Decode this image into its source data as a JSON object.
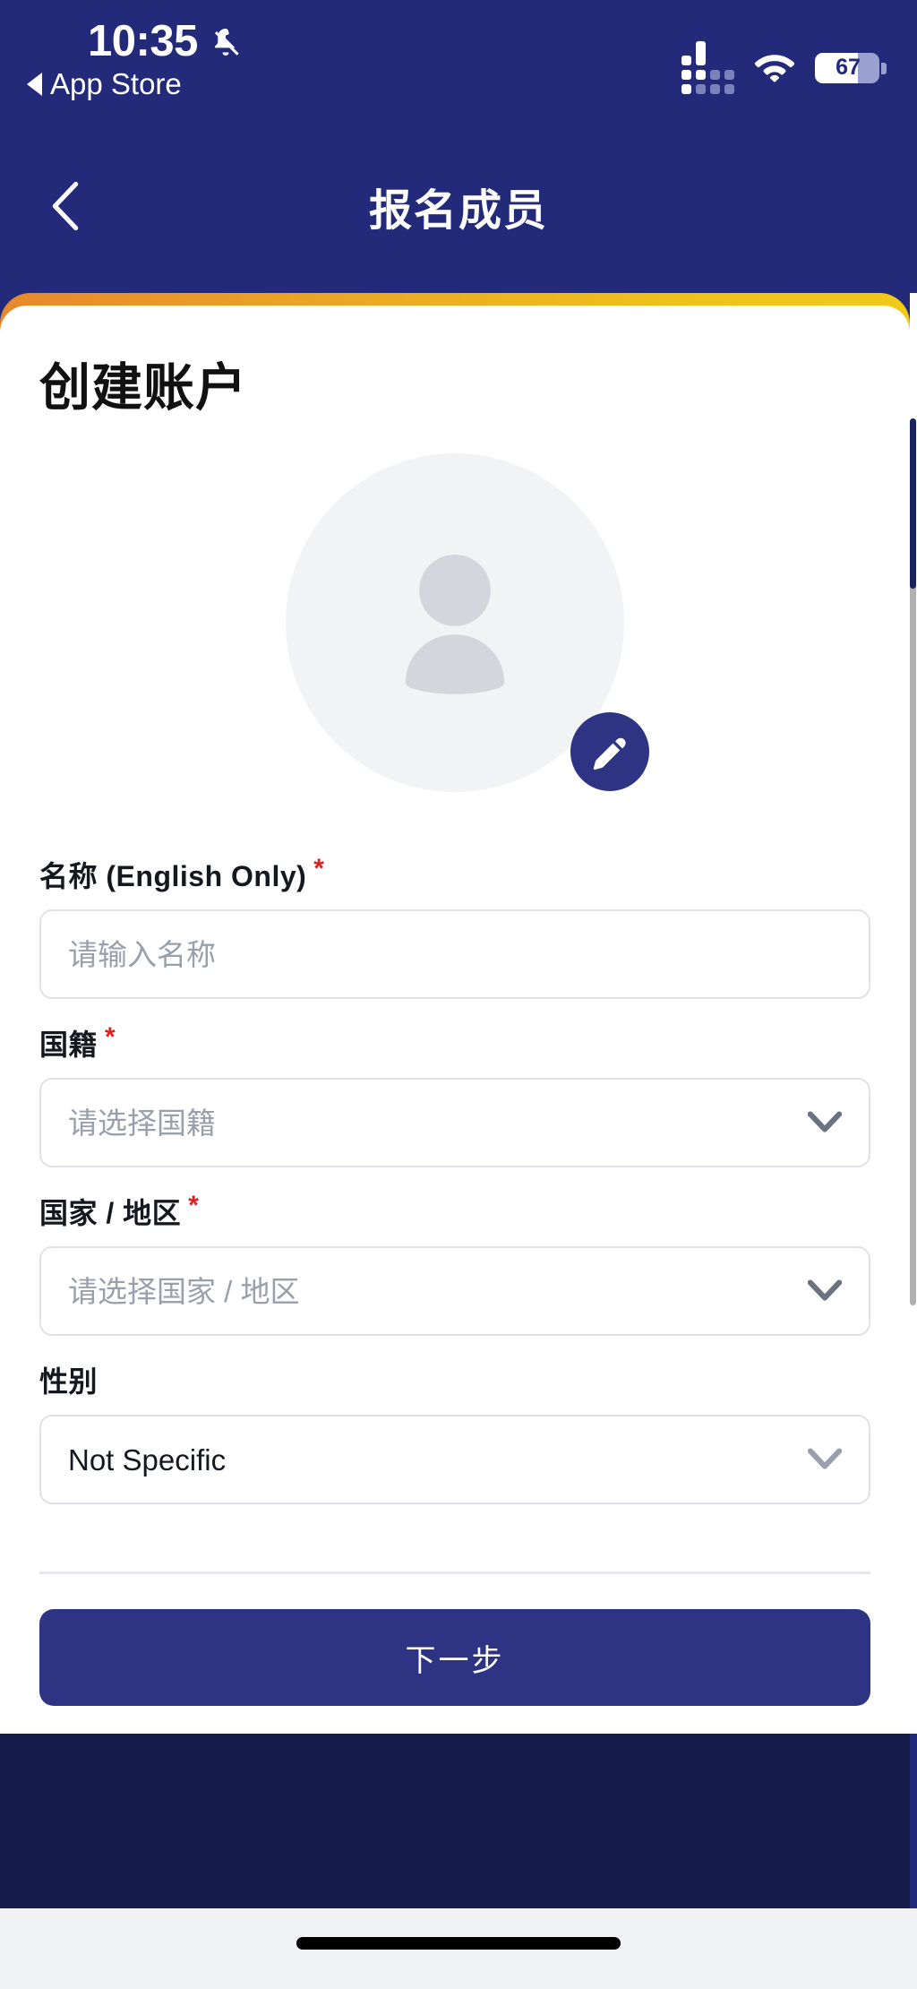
{
  "status_bar": {
    "time": "10:35",
    "bell_icon": "bell-muted-icon",
    "return_label": "App Store",
    "return_arrow_icon": "triangle-left-icon",
    "signal_icon": "cellular-signal-icon",
    "wifi_icon": "wifi-icon",
    "battery_percent": "67",
    "battery_level": 67
  },
  "nav": {
    "back_icon": "chevron-left-icon",
    "title": "报名成员"
  },
  "card": {
    "title": "创建账户",
    "gradient_start": "#E8892C",
    "gradient_end": "#F0CA18"
  },
  "avatar": {
    "placeholder_icon": "person-icon",
    "edit_icon": "pencil-icon",
    "edit_badge_color": "#2E3383"
  },
  "form": {
    "fields": [
      {
        "label": "名称 (English Only)",
        "required": true,
        "type": "text",
        "value": "",
        "placeholder": "请输入名称"
      },
      {
        "label": "国籍",
        "required": true,
        "type": "select",
        "value": "",
        "placeholder": "请选择国籍",
        "chevron_icon": "chevron-down-icon"
      },
      {
        "label": "国家 / 地区",
        "required": true,
        "type": "select",
        "value": "",
        "placeholder": "请选择国家 / 地区",
        "chevron_icon": "chevron-down-icon"
      },
      {
        "label": "性别",
        "required": false,
        "type": "select",
        "value": "Not Specific",
        "placeholder": "Not Specific",
        "chevron_icon": "chevron-down-icon"
      }
    ],
    "required_marker": "*"
  },
  "actions": {
    "next_label": "下一步",
    "next_color": "#2E3383"
  },
  "colors": {
    "header_navy": "#232A7A",
    "footer_navy": "#161C4A",
    "required_red": "#e02020",
    "placeholder_gray": "#9aa0ab",
    "border_gray": "#dfe2e8"
  }
}
